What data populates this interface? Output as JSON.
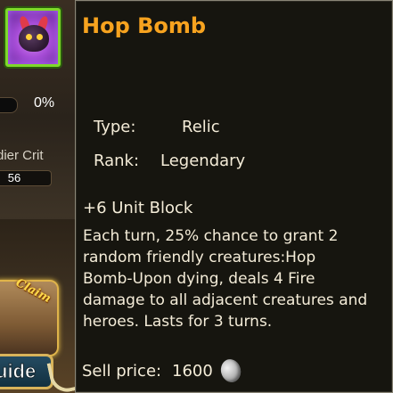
{
  "background": {
    "progress_percent_text": "0%",
    "progress_value": 0,
    "soldier_crit_label": "dier Crit",
    "soldier_crit_value": "56",
    "claim_badge": "Claim",
    "guide_button": "uide"
  },
  "tooltip": {
    "item_name": "Hop Bomb",
    "type_label": "Type:",
    "type_value": "Relic",
    "rank_label": "Rank:",
    "rank_value": "Legendary",
    "stat_line": "+6 Unit Block",
    "description": "Each turn, 25% chance to grant 2 random friendly creatures:Hop Bomb-Upon dying, deals 4 Fire damage to all adjacent creatures and heroes. Lasts for 3 turns.",
    "sell_label": "Sell price:",
    "sell_value": "1600",
    "currency_icon": "silver-coin-icon"
  },
  "colors": {
    "item_name": "#f7a31f",
    "icon_border": "#7fd92a",
    "text": "#f4ecd8"
  }
}
